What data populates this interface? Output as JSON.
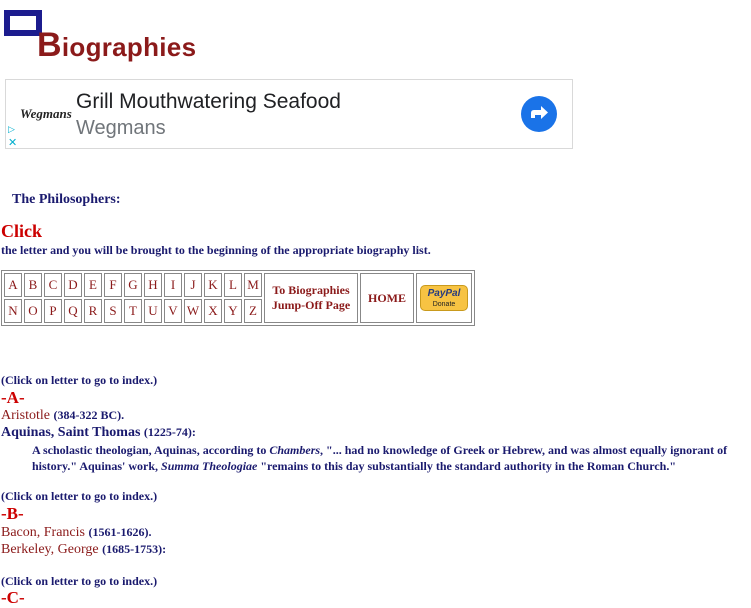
{
  "logo": {
    "first_letter": "B",
    "rest": "iographies"
  },
  "ad": {
    "brand": "Wegmans",
    "headline": "Grill Mouthwatering Seafood",
    "advertiser": "Wegmans",
    "play_glyph": "▷",
    "close_glyph": "✕",
    "icon": "arrow-right-icon"
  },
  "section_title": "The Philosophers:",
  "click_heading": "Click",
  "click_desc": "the letter and you will be brought to the beginning of the appropriate biography list.",
  "nav": {
    "row1": [
      "A",
      "B",
      "C",
      "D",
      "E",
      "F",
      "G",
      "H",
      "I",
      "J",
      "K",
      "L",
      "M"
    ],
    "row2": [
      "N",
      "O",
      "P",
      "Q",
      "R",
      "S",
      "T",
      "U",
      "V",
      "W",
      "X",
      "Y",
      "Z"
    ],
    "jump_off_line1": "To Biographies",
    "jump_off_line2": "Jump-Off Page",
    "home": "HOME",
    "paypal_logo": "PayPal",
    "paypal_donate": "Donate"
  },
  "index_note": "(Click on letter to go to index.)",
  "sections": {
    "a": {
      "heading": "-A-",
      "aristotle": {
        "name": "Aristotle",
        "dates": "(384-322 BC)."
      },
      "aquinas": {
        "name": "Aquinas, Saint Thomas",
        "dates": "(1225-74):",
        "desc_1": "A scholastic theologian, Aquinas, according to ",
        "desc_source": "Chambers",
        "desc_2": ", \"... had no knowledge of Greek or Hebrew, and was almost equally ignorant of history.\" Aquinas' work, ",
        "desc_work": "Summa Theologiae",
        "desc_3": " \"remains to this day substantially the standard authority in the Roman Church.\""
      }
    },
    "b": {
      "heading": "-B-",
      "bacon": {
        "name": "Bacon, Francis",
        "dates": "(1561-1626)."
      },
      "berkeley": {
        "name": "Berkeley, George",
        "dates": "(1685-1753):"
      }
    },
    "c": {
      "heading": "-C-"
    }
  },
  "colors": {
    "navy": "#1a1a6e",
    "maroon": "#8b1a1a",
    "red": "#cc0000",
    "ad_blue": "#1a73e8"
  }
}
